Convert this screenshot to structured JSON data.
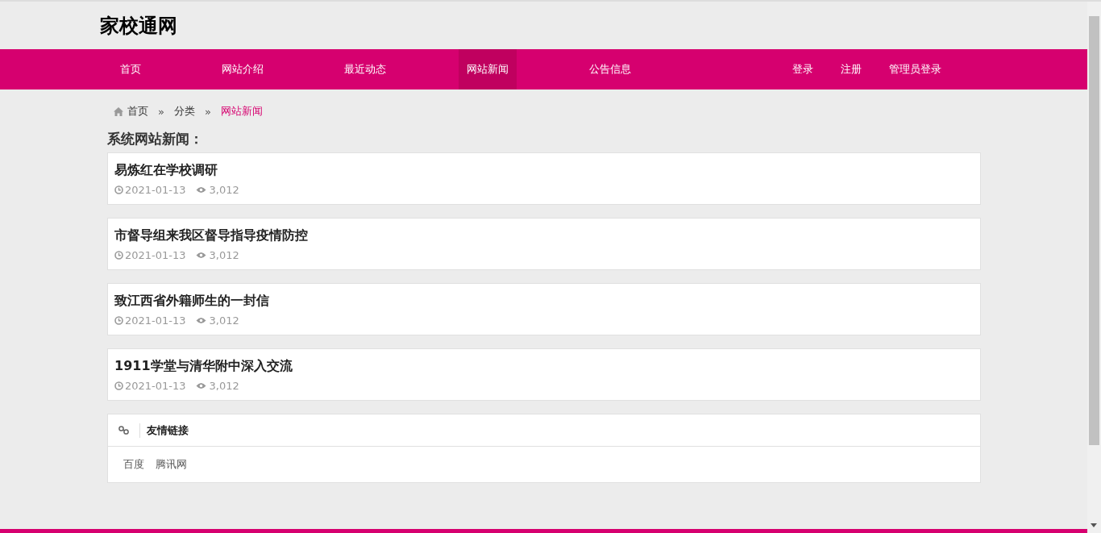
{
  "site_title": "家校通网",
  "nav": {
    "items": [
      {
        "label": "首页",
        "selected": false
      },
      {
        "label": "网站介绍",
        "selected": false
      },
      {
        "label": "最近动态",
        "selected": false
      },
      {
        "label": "网站新闻",
        "selected": true
      },
      {
        "label": "公告信息",
        "selected": false
      }
    ],
    "account_links": [
      "登录",
      "注册",
      "管理员登录"
    ]
  },
  "breadcrumb": {
    "items": [
      "首页",
      "分类",
      "网站新闻"
    ],
    "separator": "»"
  },
  "section_title": "系统网站新闻：",
  "news": [
    {
      "title": "易炼红在学校调研",
      "date": "2021-01-13",
      "views": "3,012"
    },
    {
      "title": "市督导组来我区督导指导疫情防控",
      "date": "2021-01-13",
      "views": "3,012"
    },
    {
      "title": "致江西省外籍师生的一封信",
      "date": "2021-01-13",
      "views": "3,012"
    },
    {
      "title": "1911学堂与清华附中深入交流",
      "date": "2021-01-13",
      "views": "3,012"
    }
  ],
  "friend_links": {
    "title": "友情链接",
    "links": [
      "百度",
      "腾讯网"
    ]
  }
}
